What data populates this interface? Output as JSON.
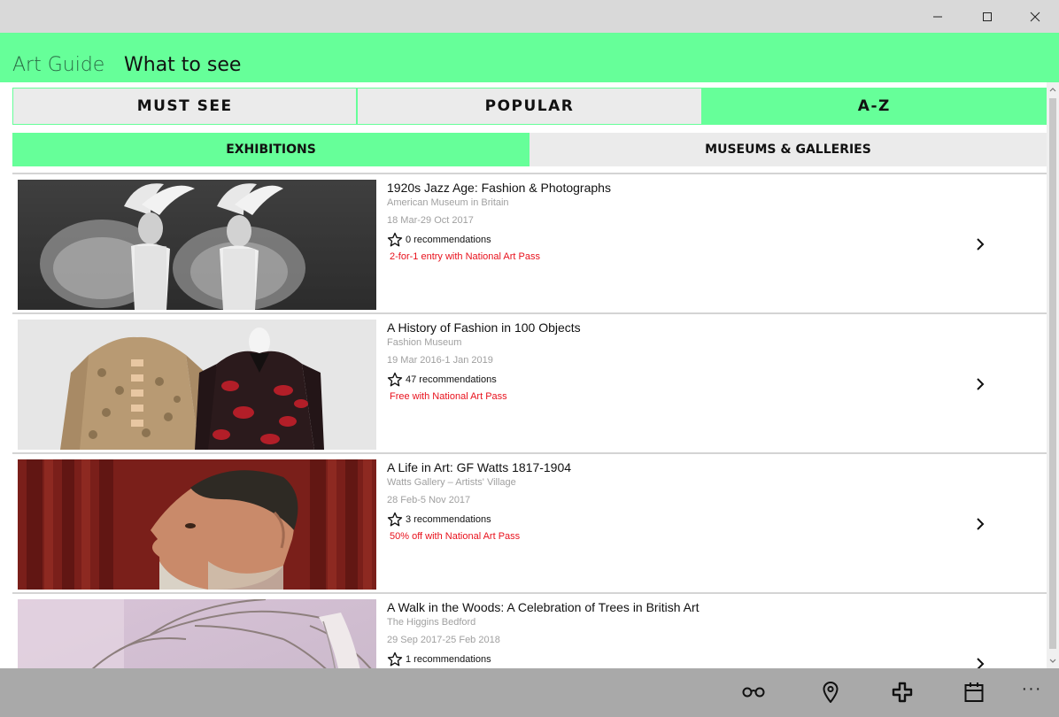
{
  "app": {
    "name": "Art Guide",
    "page_title": "What to see"
  },
  "tabs_primary": [
    {
      "label": "MUST SEE",
      "active": false
    },
    {
      "label": "POPULAR",
      "active": false
    },
    {
      "label": "A-Z",
      "active": true
    }
  ],
  "tabs_secondary": [
    {
      "label": "EXHIBITIONS",
      "active": true
    },
    {
      "label": "MUSEUMS & GALLERIES",
      "active": false
    }
  ],
  "exhibitions": [
    {
      "title": "1920s Jazz Age: Fashion & Photographs",
      "venue": "American Museum in Britain",
      "dates": "18 Mar-29 Oct 2017",
      "recommendations": "0 recommendations",
      "offer": "2-for-1 entry with National Art Pass"
    },
    {
      "title": "A History of Fashion in 100 Objects",
      "venue": "Fashion Museum",
      "dates": "19 Mar 2016-1 Jan 2019",
      "recommendations": "47 recommendations",
      "offer": "Free with National Art Pass"
    },
    {
      "title": "A Life in Art: GF Watts 1817-1904",
      "venue": "Watts Gallery – Artists' Village",
      "dates": "28 Feb-5 Nov 2017",
      "recommendations": "3 recommendations",
      "offer": "50% off with National Art Pass"
    },
    {
      "title": "A Walk in the Woods: A Celebration of Trees in British Art",
      "venue": "The Higgins Bedford",
      "dates": "29 Sep 2017-25 Feb 2018",
      "recommendations": "1 recommendations",
      "offer": ""
    }
  ],
  "command_bar": {
    "icons": [
      "glasses-icon",
      "map-pin-icon",
      "plus-icon",
      "calendar-icon"
    ],
    "more_label": "···"
  },
  "colors": {
    "accent": "#66ff99",
    "tab_inactive": "#ebebeb",
    "offer_text": "#e8111c",
    "titlebar": "#d9d9d9",
    "command_bar": "#a9a9a9"
  }
}
